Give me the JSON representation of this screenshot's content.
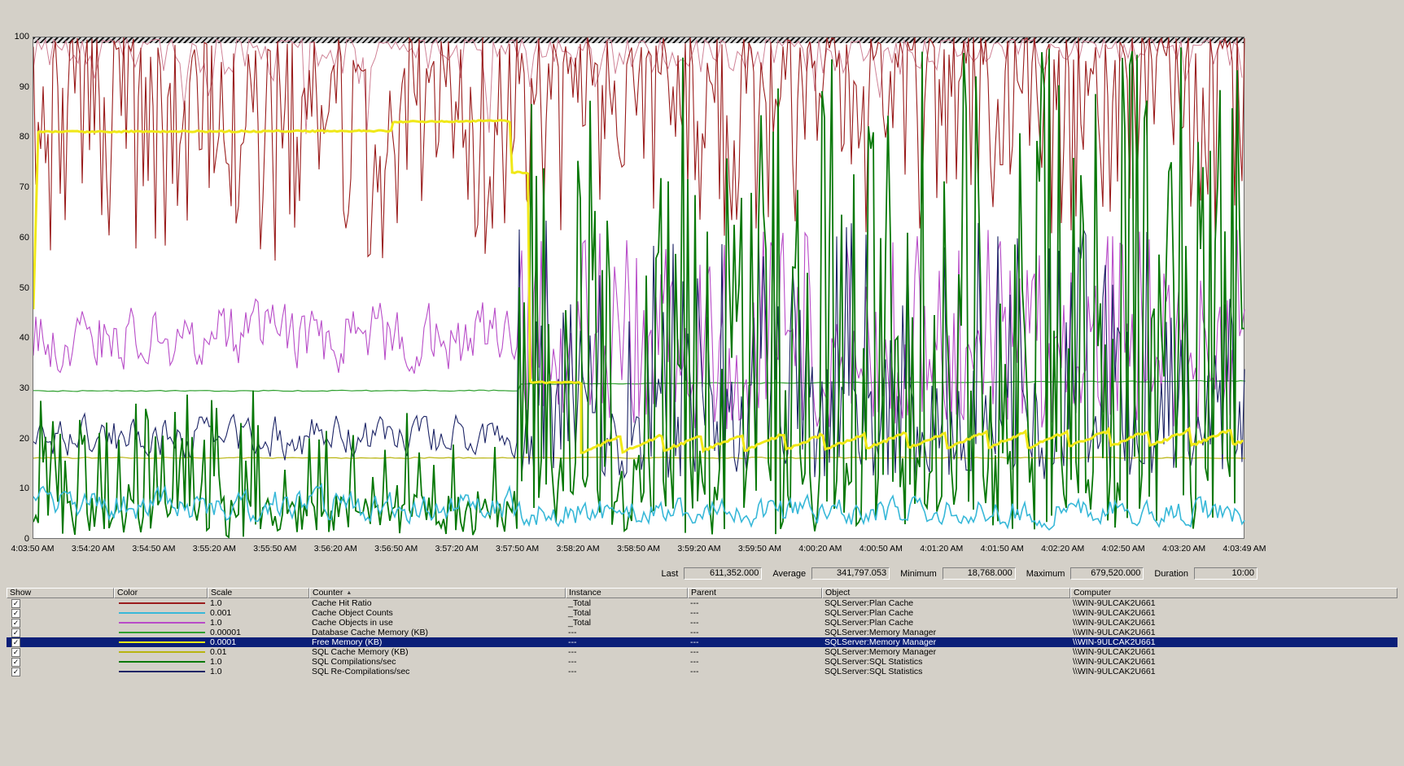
{
  "window": {
    "bg_color": "#d4d0c8",
    "selection_color": "#0a1e78"
  },
  "icons": {
    "checked": "✓",
    "sort_ascending": "▲"
  },
  "chart": {
    "y_ticks": [
      "100",
      "90",
      "80",
      "70",
      "60",
      "50",
      "40",
      "30",
      "20",
      "10",
      "0"
    ],
    "x_ticks": [
      "4:03:50 AM",
      "3:54:20 AM",
      "3:54:50 AM",
      "3:55:20 AM",
      "3:55:50 AM",
      "3:56:20 AM",
      "3:56:50 AM",
      "3:57:20 AM",
      "3:57:50 AM",
      "3:58:20 AM",
      "3:58:50 AM",
      "3:59:20 AM",
      "3:59:50 AM",
      "4:00:20 AM",
      "4:00:50 AM",
      "4:01:20 AM",
      "4:01:50 AM",
      "4:02:20 AM",
      "4:02:50 AM",
      "4:03:20 AM",
      "4:03:49 AM"
    ]
  },
  "stats": {
    "last_label": "Last",
    "last_value": "611,352.000",
    "average_label": "Average",
    "average_value": "341,797.053",
    "minimum_label": "Minimum",
    "minimum_value": "18,768.000",
    "maximum_label": "Maximum",
    "maximum_value": "679,520.000",
    "duration_label": "Duration",
    "duration_value": "10:00"
  },
  "legend": {
    "headers": [
      "Show",
      "Color",
      "Scale",
      "Counter",
      "Instance",
      "Parent",
      "Object",
      "Computer"
    ],
    "sort_column": "Counter",
    "rows": [
      {
        "checked": true,
        "selected": false,
        "color": "#9a1c1c",
        "scale": "1.0",
        "counter": "Cache Hit Ratio",
        "instance": "_Total",
        "parent": "---",
        "object": "SQLServer:Plan Cache",
        "computer": "\\\\WIN-9ULCAK2U661"
      },
      {
        "checked": true,
        "selected": false,
        "color": "#38b8d8",
        "scale": "0.001",
        "counter": "Cache Object Counts",
        "instance": "_Total",
        "parent": "---",
        "object": "SQLServer:Plan Cache",
        "computer": "\\\\WIN-9ULCAK2U661"
      },
      {
        "checked": true,
        "selected": false,
        "color": "#b84cc8",
        "scale": "1.0",
        "counter": "Cache Objects in use",
        "instance": "_Total",
        "parent": "---",
        "object": "SQLServer:Plan Cache",
        "computer": "\\\\WIN-9ULCAK2U661"
      },
      {
        "checked": true,
        "selected": false,
        "color": "#2fa02f",
        "scale": "0.00001",
        "counter": "Database Cache Memory (KB)",
        "instance": "---",
        "parent": "---",
        "object": "SQLServer:Memory Manager",
        "computer": "\\\\WIN-9ULCAK2U661"
      },
      {
        "checked": true,
        "selected": true,
        "color": "#f0e818",
        "scale": "0.0001",
        "counter": "Free Memory (KB)",
        "instance": "---",
        "parent": "---",
        "object": "SQLServer:Memory Manager",
        "computer": "\\\\WIN-9ULCAK2U661"
      },
      {
        "checked": true,
        "selected": false,
        "color": "#b8b410",
        "scale": "0.01",
        "counter": "SQL Cache Memory (KB)",
        "instance": "---",
        "parent": "---",
        "object": "SQLServer:Memory Manager",
        "computer": "\\\\WIN-9ULCAK2U661"
      },
      {
        "checked": true,
        "selected": false,
        "color": "#087808",
        "scale": "1.0",
        "counter": "SQL Compilations/sec",
        "instance": "---",
        "parent": "---",
        "object": "SQLServer:SQL Statistics",
        "computer": "\\\\WIN-9ULCAK2U661"
      },
      {
        "checked": true,
        "selected": false,
        "color": "#1c2466",
        "scale": "1.0",
        "counter": "SQL Re-Compilations/sec",
        "instance": "---",
        "parent": "---",
        "object": "SQLServer:SQL Statistics",
        "computer": "\\\\WIN-9ULCAK2U661"
      }
    ]
  },
  "chart_data": {
    "type": "line",
    "title": "",
    "xlabel": "",
    "ylabel": "",
    "ylim": [
      0,
      100
    ],
    "grid": false,
    "legend_position": "bottom-table",
    "duration": "10:00",
    "series": [
      {
        "key": "sql-cache-memory",
        "name": "SQL Cache Memory (KB)",
        "color": "#b8b410",
        "width": 1.2,
        "seed": 106,
        "approx": "flat line near 16 (scaled) across the whole window",
        "gen": {
          "kind": "segs",
          "step": 6,
          "noise": 0.24,
          "segs": [
            [
              0,
              1,
              16.3,
              16.3
            ]
          ]
        }
      },
      {
        "key": "database-cache-memory",
        "name": "Database Cache Memory (KB)",
        "color": "#2fa02f",
        "width": 1.2,
        "seed": 104,
        "approx": "flat near 29.6, steps up to ~31 at 3:58 AM then slowly rises to ~31.6",
        "gen": {
          "kind": "segs",
          "step": 6,
          "noise": 0.2,
          "segs": [
            [
              0,
              0.4,
              29.6,
              29.7
            ],
            [
              0.4,
              0.402,
              29.7,
              31.0
            ],
            [
              0.402,
              1,
              31.0,
              31.6
            ]
          ]
        }
      },
      {
        "key": "upper-boundary-line",
        "name": "thin upper line near 100",
        "color": "#cf8296",
        "width": 1,
        "seed": 109,
        "approx": "meanders 92-100 with occasional dips to ~80",
        "gen": {
          "kind": "half",
          "step": 5,
          "breakT": 0.4,
          "left": {
            "m": "biased",
            "top": 99.6,
            "span": 9,
            "pow": 2.2,
            "rp": 0.05,
            "rLo": 80,
            "rHi": 92
          },
          "right": {
            "m": "biased",
            "top": 99.6,
            "span": 7,
            "pow": 2.2,
            "rp": 0.03,
            "rLo": 86,
            "rHi": 94
          }
        }
      },
      {
        "key": "cache-hit-ratio",
        "name": "Cache Hit Ratio",
        "color": "#9a1c1c",
        "width": 1.1,
        "seed": 101,
        "approx": "wildly oscillating 55-100%",
        "gen": {
          "kind": "half",
          "step": 3,
          "breakT": 0.4,
          "left": {
            "m": "biased",
            "top": 100,
            "span": 45,
            "pow": 1.6
          },
          "right": {
            "m": "biased",
            "top": 100,
            "span": 40,
            "pow": 1.9
          }
        }
      },
      {
        "key": "cache-objects-in-use",
        "name": "Cache Objects in use",
        "color": "#b84cc8",
        "width": 1.1,
        "seed": 103,
        "approx": "noisy band ~30-52 before 3:58 AM, spiky 22-62 after",
        "gen": {
          "kind": "half",
          "step": 3,
          "breakT": 0.4,
          "left": {
            "m": "smooth",
            "base": 40.5,
            "amp": 9,
            "k": 0.35,
            "lo": 27,
            "hi": 54
          },
          "right": {
            "m": "two",
            "p": 0.32,
            "sLo": 40,
            "sHi": 62,
            "bLo": 22,
            "bHi": 42
          }
        }
      },
      {
        "key": "sql-recompilations",
        "name": "SQL Re-Compilations/sec",
        "color": "#1c2466",
        "width": 1.1,
        "seed": 108,
        "approx": "meanders 13-28 before 3:58 AM, spiky 12-64 after",
        "gen": {
          "kind": "half",
          "step": 3,
          "breakT": 0.4,
          "left": {
            "m": "smooth",
            "base": 20.5,
            "amp": 6.5,
            "k": 0.45,
            "lo": 13,
            "hi": 28
          },
          "right": {
            "m": "two",
            "p": 0.3,
            "sLo": 30,
            "sHi": 64,
            "bLo": 12,
            "bHi": 32
          }
        }
      },
      {
        "key": "sql-compilations",
        "name": "SQL Compilations/sec",
        "color": "#087808",
        "width": 1.8,
        "seed": 107,
        "approx": "spiky 0-30 before 3:58 AM, dense tall spikes 0-100 after",
        "gen": {
          "kind": "half",
          "step": 3,
          "breakT": 0.4,
          "left": {
            "m": "two",
            "p": 0.25,
            "sLo": 8,
            "sHi": 30,
            "bLo": 0.5,
            "bHi": 9
          },
          "right": {
            "m": "two",
            "p": 0.5,
            "sLo": 28,
            "sHi": 100,
            "bLo": 1,
            "bHi": 18
          }
        }
      },
      {
        "key": "cache-object-counts",
        "name": "Cache Object Counts",
        "color": "#38b8d8",
        "width": 1.6,
        "seed": 102,
        "approx": "noisy band ~2-12 along the bottom",
        "gen": {
          "kind": "half",
          "step": 3,
          "breakT": 0.4,
          "left": {
            "m": "smooth",
            "base": 6.8,
            "amp": 4.8,
            "k": 0.45,
            "lo": 1.8,
            "hi": 13
          },
          "right": {
            "m": "smooth",
            "base": 5.6,
            "amp": 4.2,
            "k": 0.45,
            "lo": 1.8,
            "hi": 12
          }
        }
      },
      {
        "key": "free-memory",
        "name": "Free Memory (KB)",
        "color": "#f0e818",
        "width": 3,
        "seed": 105,
        "approx": "selected/bold: flat ~81 then ~83, steps down to 73 at 3:57:50, to ~31 at 3:58:20, then sawtooth 17-21 to end",
        "gen": {
          "kind": "segs",
          "step": 3,
          "noise": 0.3,
          "segs": [
            [
              0,
              0.004,
              46,
              81.2
            ],
            [
              0.004,
              0.295,
              81.2,
              81.4
            ],
            [
              0.295,
              0.297,
              81.4,
              83.2
            ],
            [
              0.297,
              0.393,
              83.2,
              83.4
            ],
            [
              0.393,
              0.395,
              83.4,
              73.2
            ],
            [
              0.395,
              0.408,
              73.2,
              73.0
            ],
            [
              0.408,
              0.41,
              73.0,
              31.4
            ],
            [
              0.41,
              0.452,
              31.4,
              31.2
            ]
          ],
          "saw": {
            "start": 0.452,
            "base": 17.4,
            "rise": 3.2,
            "period": 0.0335,
            "trend": 1.4
          }
        }
      }
    ]
  }
}
